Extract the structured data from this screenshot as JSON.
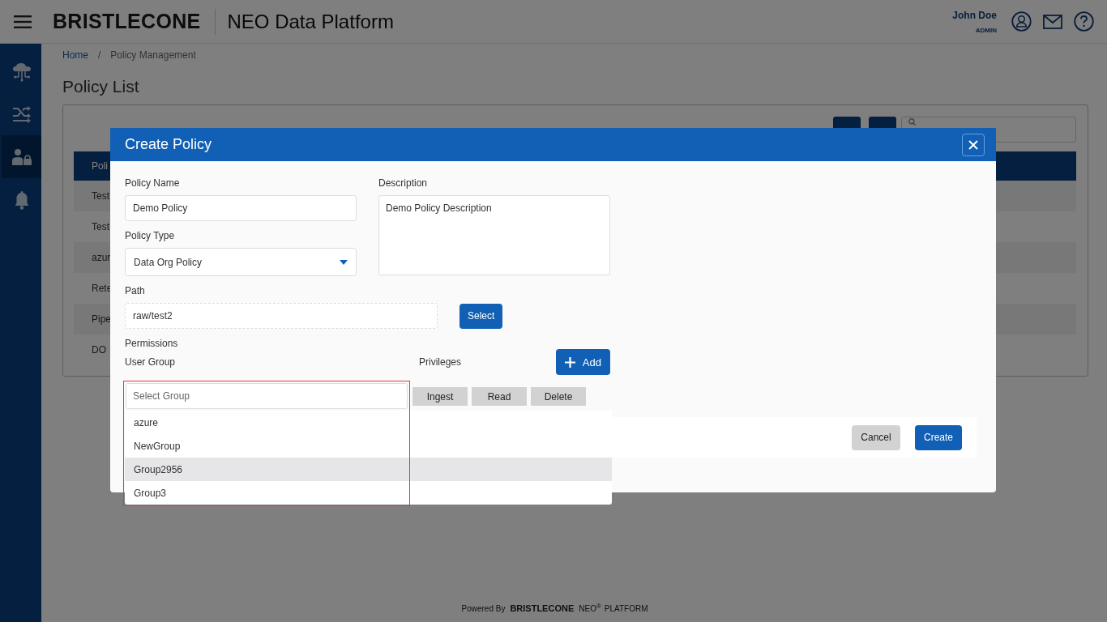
{
  "header": {
    "logo": "BRISTLECONE",
    "title": "NEO Data Platform",
    "user": {
      "name": "John Doe",
      "role": "ADMIN"
    }
  },
  "sidebar": {
    "items": [
      {
        "kind": "cloud",
        "selected": false
      },
      {
        "kind": "sliders",
        "selected": false
      },
      {
        "kind": "user-lock",
        "selected": true
      },
      {
        "kind": "bell",
        "selected": false
      }
    ]
  },
  "breadcrumb": {
    "items": [
      "Home",
      "Policy Management"
    ],
    "separator": "/"
  },
  "page_title": "Policy List",
  "table": {
    "columns": [
      "Poli"
    ],
    "rows": [
      "Test",
      "Test",
      "azur",
      "Rete",
      "Pipe",
      "DO"
    ]
  },
  "dialog": {
    "title": "Create Policy",
    "policy_name": {
      "label": "Policy Name",
      "value": "Demo Policy"
    },
    "description": {
      "label": "Description",
      "value": "Demo Policy Description"
    },
    "policy_type": {
      "label": "Policy Type",
      "value": "Data Org Policy"
    },
    "path": {
      "label": "Path",
      "value": "raw/test2",
      "button": "Select"
    },
    "permissions": {
      "label": "Permissions",
      "user_group_label": "User Group",
      "privileges_label": "Privileges",
      "add_button": "Add",
      "group_select": {
        "placeholder": "Select Group",
        "options": [
          {
            "label": "azure",
            "selected": false
          },
          {
            "label": "NewGroup",
            "selected": false
          },
          {
            "label": "Group2956",
            "selected": true
          },
          {
            "label": "Group3",
            "selected": false
          }
        ]
      },
      "privileges": [
        "Ingest",
        "Read",
        "Delete"
      ]
    },
    "buttons": {
      "cancel": "Cancel",
      "create": "Create"
    }
  },
  "footer": {
    "prefix": "Powered By",
    "brand": "BRISTLECONE",
    "product": "NEO$^{®}$",
    "suffix": "PLATFORM"
  }
}
